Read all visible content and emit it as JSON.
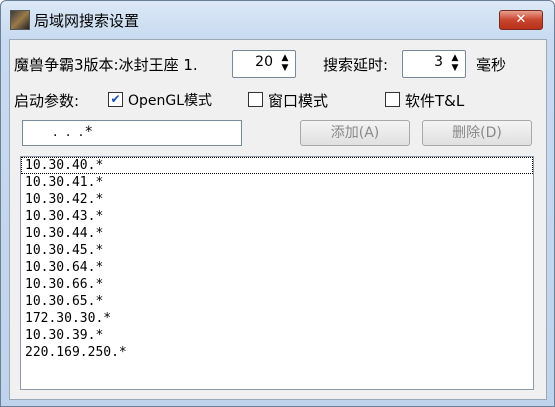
{
  "window": {
    "title": "局域网搜索设置",
    "close_label": "✕"
  },
  "version": {
    "label": "魔兽争霸3版本:冰封王座 1.",
    "value": "20"
  },
  "delay": {
    "label": "搜索延时:",
    "value": "3",
    "unit": "毫秒"
  },
  "options": {
    "label": "启动参数:",
    "items": [
      {
        "label": "OpenGL模式",
        "checked": true
      },
      {
        "label": "窗口模式",
        "checked": false
      },
      {
        "label": "软件T&L",
        "checked": false
      }
    ]
  },
  "ip_input": {
    "value": ".    .    .*"
  },
  "buttons": {
    "add": "添加(A)",
    "delete": "删除(D)"
  },
  "ip_list": [
    "10.30.40.*",
    "10.30.41.*",
    "10.30.42.*",
    "10.30.43.*",
    "10.30.44.*",
    "10.30.45.*",
    "10.30.64.*",
    "10.30.66.*",
    "10.30.65.*",
    "172.30.30.*",
    "10.30.39.*",
    "220.169.250.*"
  ]
}
